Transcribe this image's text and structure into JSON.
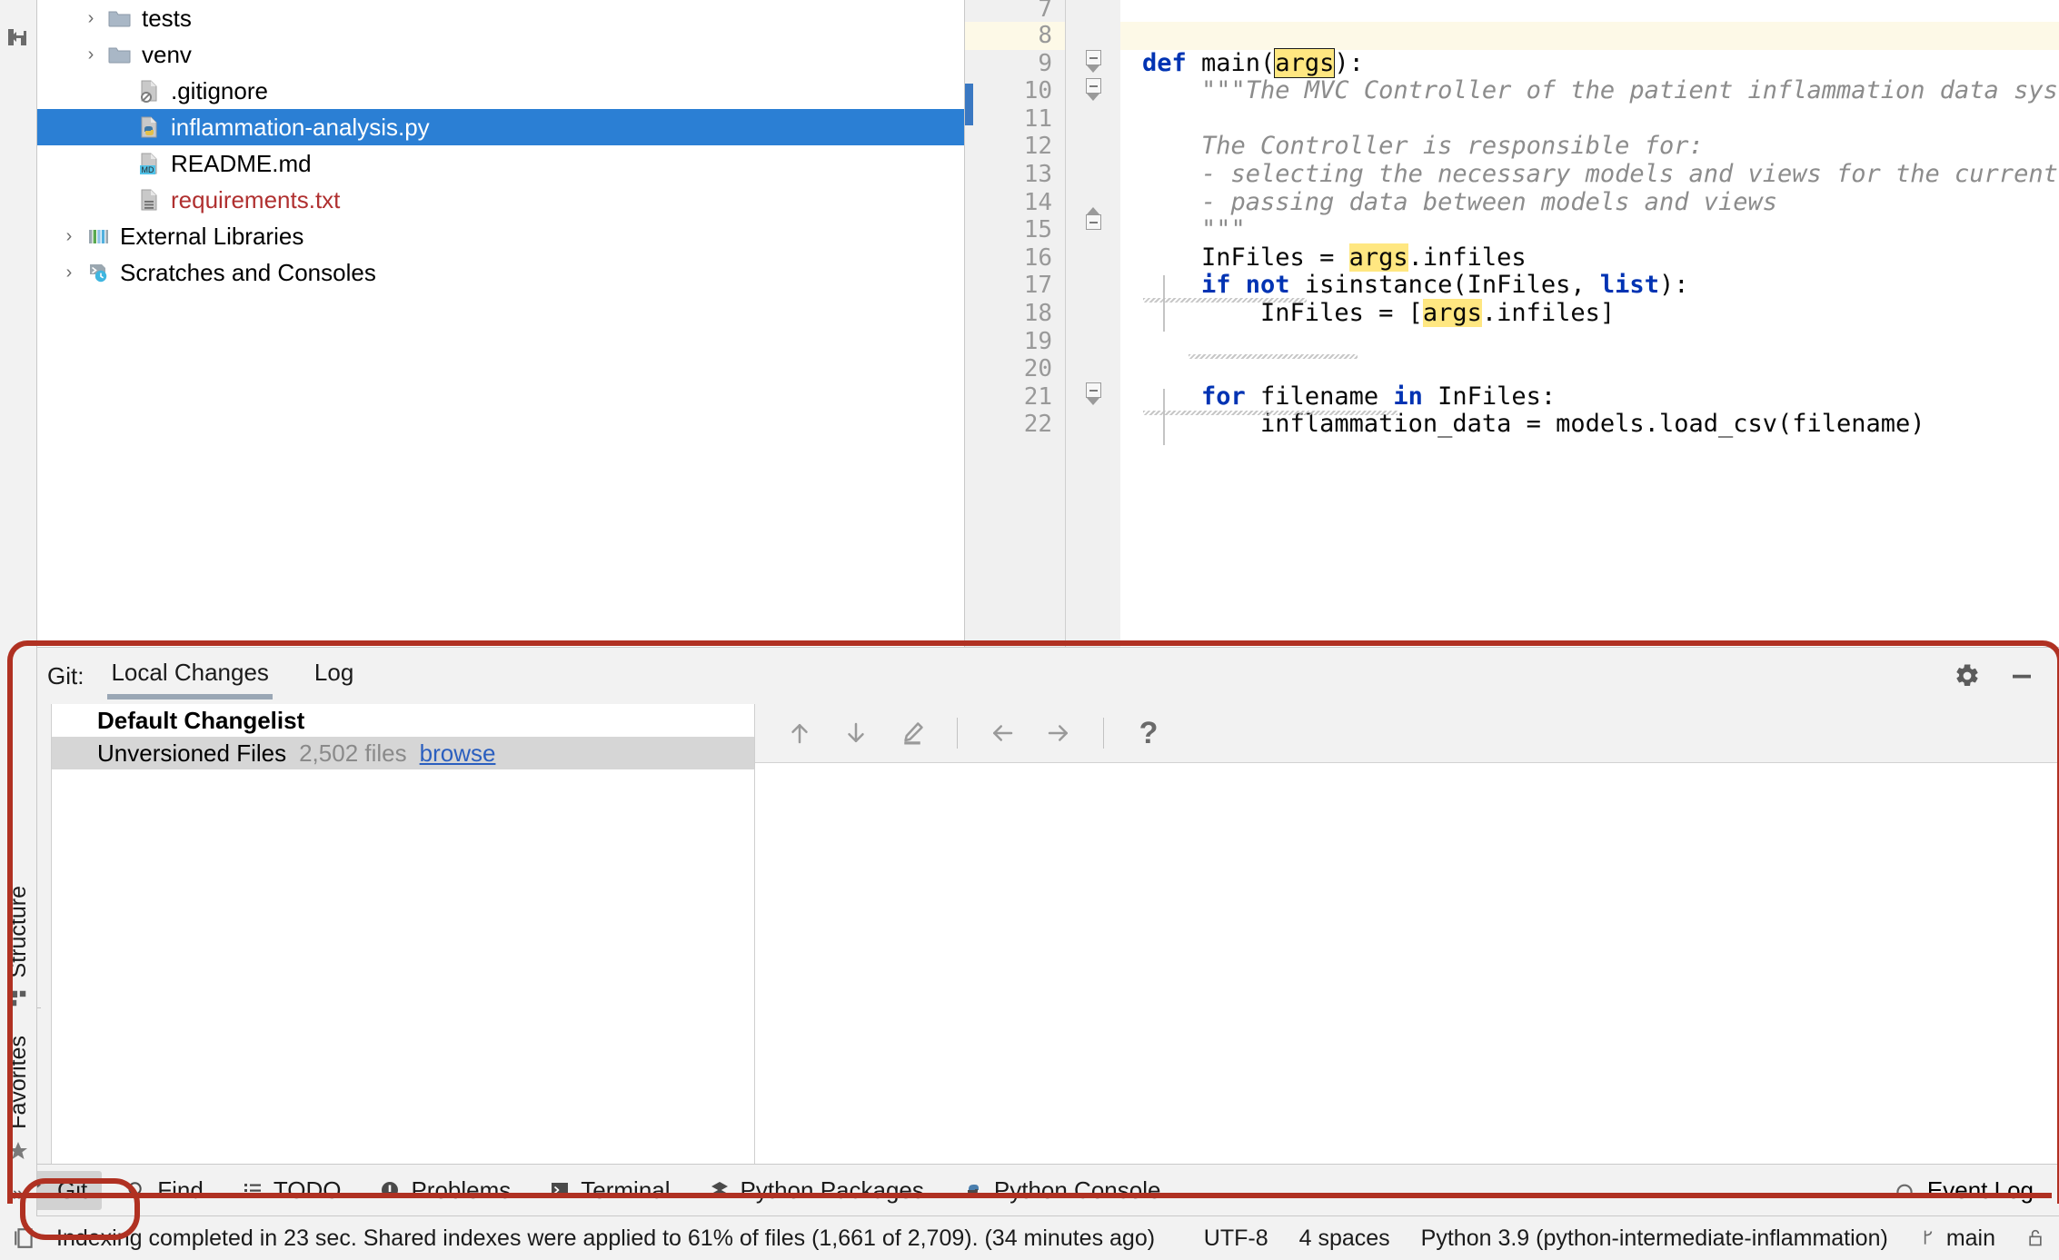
{
  "project_tree": {
    "items": [
      {
        "label": "tests",
        "icon": "folder-icon",
        "indent": 1,
        "chevron": true,
        "selected": false,
        "color": "normal"
      },
      {
        "label": "venv",
        "icon": "folder-icon",
        "indent": 1,
        "chevron": true,
        "selected": false,
        "color": "normal"
      },
      {
        "label": ".gitignore",
        "icon": "gitignore-file-icon",
        "indent": 2,
        "chevron": false,
        "selected": false,
        "color": "normal"
      },
      {
        "label": "inflammation-analysis.py",
        "icon": "python-file-icon",
        "indent": 2,
        "chevron": false,
        "selected": true,
        "color": "normal"
      },
      {
        "label": "README.md",
        "icon": "markdown-file-icon",
        "indent": 2,
        "chevron": false,
        "selected": false,
        "color": "normal"
      },
      {
        "label": "requirements.txt",
        "icon": "text-file-icon",
        "indent": 2,
        "chevron": false,
        "selected": false,
        "color": "red"
      },
      {
        "label": "External Libraries",
        "icon": "libraries-icon",
        "indent": 0,
        "chevron": true,
        "selected": false,
        "color": "normal"
      },
      {
        "label": "Scratches and Consoles",
        "icon": "scratches-icon",
        "indent": 0,
        "chevron": true,
        "selected": false,
        "color": "normal"
      }
    ]
  },
  "left_rail": {
    "collapse_icon": "collapse-panel-icon",
    "structure_label": "Structure",
    "structure_icon": "structure-icon",
    "favorites_label": "Favorites",
    "favorites_icon": "star-icon",
    "overflow_label": "»"
  },
  "editor": {
    "current_line": 8,
    "lines": [
      {
        "n": "7",
        "segments": [
          {
            "t": "",
            "c": "plain"
          }
        ]
      },
      {
        "n": "8",
        "segments": [
          {
            "t": "",
            "c": "plain"
          }
        ]
      },
      {
        "n": "9",
        "segments": [
          {
            "t": "def ",
            "c": "kw"
          },
          {
            "t": "main(",
            "c": "plain"
          },
          {
            "t": "args",
            "c": "hlbox"
          },
          {
            "t": "):",
            "c": "plain"
          }
        ]
      },
      {
        "n": "10",
        "segments": [
          {
            "t": "    \"\"\"The MVC Controller of the patient inflammation data system.",
            "c": "doc"
          }
        ]
      },
      {
        "n": "11",
        "segments": [
          {
            "t": "",
            "c": "plain"
          }
        ]
      },
      {
        "n": "12",
        "segments": [
          {
            "t": "    The Controller is responsible for:",
            "c": "doc"
          }
        ]
      },
      {
        "n": "13",
        "segments": [
          {
            "t": "    - selecting the necessary models and views for the current task",
            "c": "doc"
          }
        ]
      },
      {
        "n": "14",
        "segments": [
          {
            "t": "    - passing data between models and views",
            "c": "doc"
          }
        ]
      },
      {
        "n": "15",
        "segments": [
          {
            "t": "    \"\"\"",
            "c": "doc"
          }
        ]
      },
      {
        "n": "16",
        "segments": [
          {
            "t": "    InFiles = ",
            "c": "plain"
          },
          {
            "t": "args",
            "c": "hl"
          },
          {
            "t": ".infiles",
            "c": "plain"
          }
        ]
      },
      {
        "n": "17",
        "segments": [
          {
            "t": "    if not ",
            "c": "kw"
          },
          {
            "t": "isinstance(InFiles, ",
            "c": "plain"
          },
          {
            "t": "list",
            "c": "kw"
          },
          {
            "t": "):",
            "c": "plain"
          }
        ]
      },
      {
        "n": "18",
        "segments": [
          {
            "t": "        InFiles = [",
            "c": "plain"
          },
          {
            "t": "args",
            "c": "hl"
          },
          {
            "t": ".infiles]",
            "c": "plain"
          }
        ]
      },
      {
        "n": "19",
        "segments": [
          {
            "t": "",
            "c": "plain"
          }
        ]
      },
      {
        "n": "20",
        "segments": [
          {
            "t": "",
            "c": "plain"
          }
        ]
      },
      {
        "n": "21",
        "segments": [
          {
            "t": "    for ",
            "c": "kw"
          },
          {
            "t": "filename ",
            "c": "plain"
          },
          {
            "t": "in ",
            "c": "kw"
          },
          {
            "t": "InFiles:",
            "c": "plain"
          }
        ]
      },
      {
        "n": "22",
        "segments": [
          {
            "t": "        inflammation_data = models.load_csv(filename)",
            "c": "plain"
          }
        ]
      }
    ]
  },
  "git_panel": {
    "label": "Git:",
    "tabs": [
      {
        "label": "Local Changes",
        "active": true
      },
      {
        "label": "Log",
        "active": false
      }
    ],
    "settings_icon": "gear-icon",
    "minimize_icon": "minimize-icon",
    "toolbar_icons": [
      {
        "name": "refresh-icon",
        "state": "enabled"
      },
      {
        "name": "commit-checkmark-icon",
        "state": "green"
      },
      {
        "name": "rollback-icon",
        "state": "disabled"
      },
      {
        "name": "merge-icon",
        "state": "disabled"
      },
      {
        "name": "changelist-icon",
        "state": "enabled"
      },
      {
        "name": "shelve-icon",
        "state": "disabled"
      },
      {
        "name": "group-by-icon",
        "state": "enabled"
      },
      {
        "name": "preview-eye-icon",
        "state": "enabled"
      },
      {
        "name": "expand-collapse-icon",
        "state": "enabled"
      }
    ],
    "changelist": {
      "title": "Default Changelist",
      "unversioned_label": "Unversioned Files",
      "unversioned_count": "2,502 files",
      "browse_link": "browse"
    },
    "diff_toolbar": [
      {
        "name": "previous-difference-icon",
        "glyph": "↑"
      },
      {
        "name": "next-difference-icon",
        "glyph": "↓"
      },
      {
        "name": "edit-source-icon",
        "glyph": "pencil"
      },
      {
        "name": "separator",
        "glyph": ""
      },
      {
        "name": "accept-left-icon",
        "glyph": "←"
      },
      {
        "name": "accept-right-icon",
        "glyph": "→"
      },
      {
        "name": "separator",
        "glyph": ""
      },
      {
        "name": "help-icon",
        "glyph": "?"
      }
    ]
  },
  "tool_window_bar": {
    "items": [
      {
        "label": "Git",
        "icon": "git-branch-icon",
        "active": true
      },
      {
        "label": "Find",
        "icon": "search-icon",
        "active": false
      },
      {
        "label": "TODO",
        "icon": "todo-list-icon",
        "active": false
      },
      {
        "label": "Problems",
        "icon": "problems-icon",
        "active": false
      },
      {
        "label": "Terminal",
        "icon": "terminal-icon",
        "active": false
      },
      {
        "label": "Python Packages",
        "icon": "packages-icon",
        "active": false
      },
      {
        "label": "Python Console",
        "icon": "python-icon",
        "active": false
      }
    ],
    "event_log": {
      "label": "Event Log",
      "icon": "event-log-icon"
    }
  },
  "status_bar": {
    "message_icon": "indexing-icon",
    "message": "Indexing completed in 23 sec. Shared indexes were applied to 61% of files (1,661 of 2,709). (34 minutes ago)",
    "encoding": "UTF-8",
    "indent": "4 spaces",
    "interpreter": "Python 3.9 (python-intermediate-inflammation)",
    "branch_icon": "git-branch-icon",
    "branch": "main",
    "lock_icon": "lock-icon"
  },
  "colors": {
    "selection_blue": "#2b7fd4",
    "highlight_yellow": "#ffe781",
    "annotation_red": "#b03122",
    "keyword_blue": "#0033b3",
    "doc_gray": "#8c8c8c",
    "link_blue": "#2b5fbf",
    "error_red": "#b03030"
  }
}
